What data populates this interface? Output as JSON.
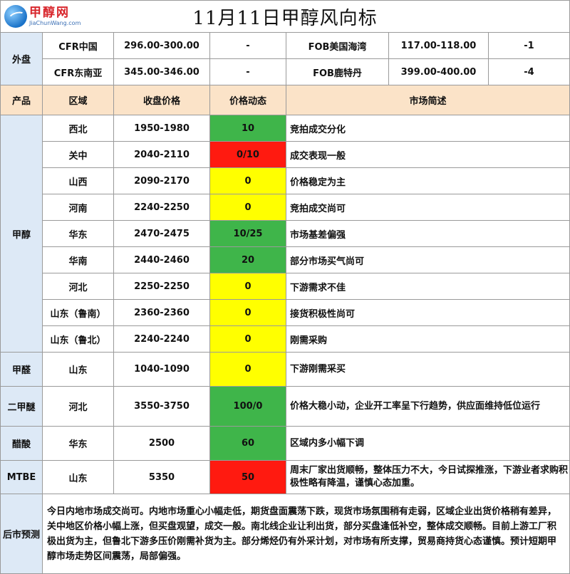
{
  "header": {
    "logo_cn": "甲醇网",
    "logo_en": "JiaChunWang.com",
    "title": "11月11日甲醇风向标"
  },
  "foreign": {
    "label": "外盘",
    "rows": [
      {
        "name_a": "CFR中国",
        "price_a": "296.00-300.00",
        "chg_a": "-",
        "name_b": "FOB美国海湾",
        "price_b": "117.00-118.00",
        "chg_b": "-1"
      },
      {
        "name_a": "CFR东南亚",
        "price_a": "345.00-346.00",
        "chg_a": "-",
        "name_b": "FOB鹿特丹",
        "price_b": "399.00-400.00",
        "chg_b": "-4"
      }
    ]
  },
  "columns": {
    "product": "产品",
    "region": "区域",
    "price": "收盘价格",
    "trend": "价格动态",
    "desc": "市场简述"
  },
  "methanol": {
    "product": "甲醇",
    "rows": [
      {
        "region": "西北",
        "price": "1950-1980",
        "trend": "10",
        "color": "#3fb54a",
        "desc": "竞拍成交分化"
      },
      {
        "region": "关中",
        "price": "2040-2110",
        "trend": "0/10",
        "color": "#ff1a10",
        "desc": "成交表现一般"
      },
      {
        "region": "山西",
        "price": "2090-2170",
        "trend": "0",
        "color": "#ffff00",
        "desc": "价格稳定为主"
      },
      {
        "region": "河南",
        "price": "2240-2250",
        "trend": "0",
        "color": "#ffff00",
        "desc": "竞拍成交尚可"
      },
      {
        "region": "华东",
        "price": "2470-2475",
        "trend": "10/25",
        "color": "#3fb54a",
        "desc": "市场基差偏强"
      },
      {
        "region": "华南",
        "price": "2440-2460",
        "trend": "20",
        "color": "#3fb54a",
        "desc": "部分市场买气尚可"
      },
      {
        "region": "河北",
        "price": "2250-2250",
        "trend": "0",
        "color": "#ffff00",
        "desc": "下游需求不佳"
      },
      {
        "region": "山东（鲁南）",
        "price": "2360-2360",
        "trend": "0",
        "color": "#ffff00",
        "desc": "接货积极性尚可"
      },
      {
        "region": "山东（鲁北）",
        "price": "2240-2240",
        "trend": "0",
        "color": "#ffff00",
        "desc": "刚需采购"
      }
    ]
  },
  "others": [
    {
      "product": "甲醛",
      "region": "山东",
      "price": "1040-1090",
      "trend": "0",
      "color": "#ffff00",
      "desc": "下游刚需采买"
    },
    {
      "product": "二甲醚",
      "region": "河北",
      "price": "3550-3750",
      "trend": "100/0",
      "color": "#3fb54a",
      "desc": "价格大稳小动，企业开工率呈下行趋势，供应面维持低位运行"
    },
    {
      "product": "醋酸",
      "region": "华东",
      "price": "2500",
      "trend": "60",
      "color": "#3fb54a",
      "desc": "区域内多小幅下调"
    },
    {
      "product": "MTBE",
      "region": "山东",
      "price": "5350",
      "trend": "50",
      "color": "#ff1a10",
      "desc": "周末厂家出货顺畅，整体压力不大，今日试探推涨，下游业者求购积极性略有降温，谨慎心态加重。"
    }
  ],
  "forecast": {
    "label": "后市预测",
    "text": "今日内地市场成交尚可。内地市场重心小幅走低，期货盘面震荡下跌，现货市场氛围稍有走弱，区域企业出货价格稍有差异，关中地区价格小幅上涨，但买盘观望，成交一般。南北线企业让利出货，部分买盘逢低补空，整体成交顺畅。目前上游工厂积极出货为主，但鲁北下游多压价刚需补货为主。部分烯烃仍有外采计划，对市场有所支撑，贸易商持货心态谨慎。预计短期甲醇市场走势区间震荡，局部偏强。"
  }
}
